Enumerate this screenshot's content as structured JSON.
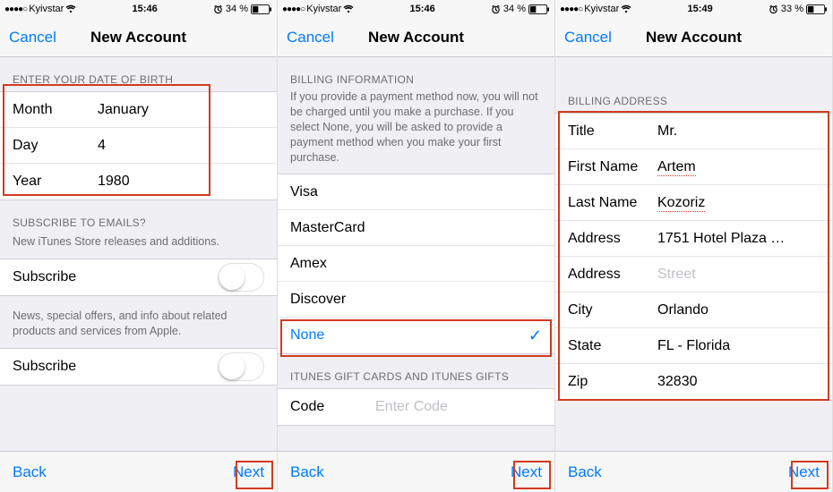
{
  "screens": [
    {
      "status": {
        "carrier": "Kyivstar",
        "time": "15:46",
        "battery": "34 %"
      },
      "nav": {
        "cancel": "Cancel",
        "title": "New Account"
      },
      "dob_header": "ENTER YOUR DATE OF BIRTH",
      "dob": {
        "month_label": "Month",
        "month": "January",
        "day_label": "Day",
        "day": "4",
        "year_label": "Year",
        "year": "1980"
      },
      "sub_header": "SUBSCRIBE TO EMAILS?",
      "sub_caption": "New iTunes Store releases and additions.",
      "subscribe_label": "Subscribe",
      "offers_caption": "News, special offers, and info about related products and services from Apple.",
      "footer": {
        "back": "Back",
        "next": "Next"
      }
    },
    {
      "status": {
        "carrier": "Kyivstar",
        "time": "15:46",
        "battery": "34 %"
      },
      "nav": {
        "cancel": "Cancel",
        "title": "New Account"
      },
      "billing_header": "BILLING INFORMATION",
      "billing_caption": "If you provide a payment method now, you will not be charged until you make a purchase. If you select None, you will be asked to provide a payment method when you make your first purchase.",
      "payment": [
        "Visa",
        "MasterCard",
        "Amex",
        "Discover",
        "None"
      ],
      "selected_payment": "None",
      "gift_header": "ITUNES GIFT CARDS AND ITUNES GIFTS",
      "code_label": "Code",
      "code_placeholder": "Enter Code",
      "footer": {
        "back": "Back",
        "next": "Next"
      }
    },
    {
      "status": {
        "carrier": "Kyivstar",
        "time": "15:49",
        "battery": "33 %"
      },
      "nav": {
        "cancel": "Cancel",
        "title": "New Account"
      },
      "addr_header": "BILLING ADDRESS",
      "addr": {
        "title_label": "Title",
        "title": "Mr.",
        "first_label": "First Name",
        "first": "Artem",
        "last_label": "Last Name",
        "last": "Kozoriz",
        "addr1_label": "Address",
        "addr1": "1751 Hotel Plaza …",
        "addr2_label": "Address",
        "addr2": "Street",
        "city_label": "City",
        "city": "Orlando",
        "state_label": "State",
        "state": "FL - Florida",
        "zip_label": "Zip",
        "zip": "32830"
      },
      "footer": {
        "back": "Back",
        "next": "Next"
      }
    }
  ]
}
